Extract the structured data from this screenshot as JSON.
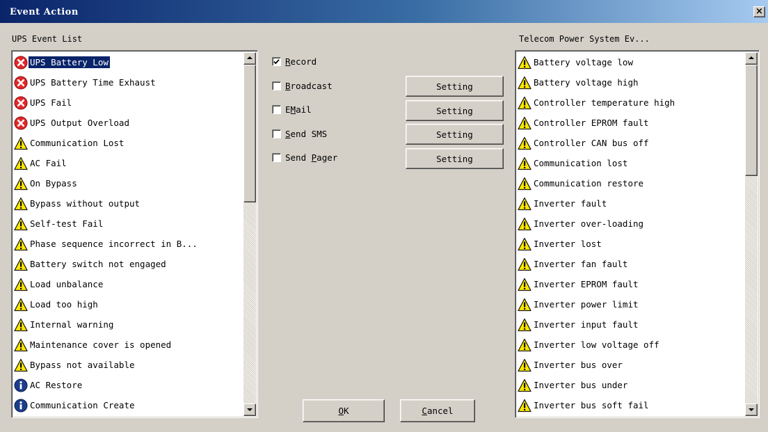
{
  "window": {
    "title": "Event Action",
    "close_label": "×"
  },
  "left_list": {
    "caption": "UPS Event List",
    "selected_index": 0,
    "items": [
      {
        "label": "UPS Battery Low",
        "icon": "error-icon"
      },
      {
        "label": "UPS Battery Time Exhaust",
        "icon": "error-icon"
      },
      {
        "label": "UPS Fail",
        "icon": "error-icon"
      },
      {
        "label": "UPS Output Overload",
        "icon": "error-icon"
      },
      {
        "label": "Communication Lost",
        "icon": "warning-icon"
      },
      {
        "label": "AC Fail",
        "icon": "warning-icon"
      },
      {
        "label": "On Bypass",
        "icon": "warning-icon"
      },
      {
        "label": "Bypass without output",
        "icon": "warning-icon"
      },
      {
        "label": "Self-test Fail",
        "icon": "warning-icon"
      },
      {
        "label": "Phase sequence incorrect in B...",
        "icon": "warning-icon"
      },
      {
        "label": "Battery switch not engaged",
        "icon": "warning-icon"
      },
      {
        "label": "Load unbalance",
        "icon": "warning-icon"
      },
      {
        "label": "Load too high",
        "icon": "warning-icon"
      },
      {
        "label": "Internal warning",
        "icon": "warning-icon"
      },
      {
        "label": "Maintenance cover is opened",
        "icon": "warning-icon"
      },
      {
        "label": "Bypass not available",
        "icon": "warning-icon"
      },
      {
        "label": "AC Restore",
        "icon": "info-icon"
      },
      {
        "label": "Communication Create",
        "icon": "info-icon"
      }
    ]
  },
  "right_list": {
    "caption": "Telecom Power System Ev...",
    "items": [
      {
        "label": "Battery voltage low",
        "icon": "warning-icon"
      },
      {
        "label": "Battery voltage high",
        "icon": "warning-icon"
      },
      {
        "label": "Controller temperature high",
        "icon": "warning-icon"
      },
      {
        "label": "Controller EPROM fault",
        "icon": "warning-icon"
      },
      {
        "label": "Controller CAN bus off",
        "icon": "warning-icon"
      },
      {
        "label": "Communication lost",
        "icon": "warning-icon"
      },
      {
        "label": "Communication restore",
        "icon": "warning-icon"
      },
      {
        "label": "Inverter fault",
        "icon": "warning-icon"
      },
      {
        "label": "Inverter over-loading",
        "icon": "warning-icon"
      },
      {
        "label": "Inverter lost",
        "icon": "warning-icon"
      },
      {
        "label": "Inverter fan fault",
        "icon": "warning-icon"
      },
      {
        "label": "Inverter EPROM fault",
        "icon": "warning-icon"
      },
      {
        "label": "Inverter power limit",
        "icon": "warning-icon"
      },
      {
        "label": "Inverter input fault",
        "icon": "warning-icon"
      },
      {
        "label": "Inverter low voltage off",
        "icon": "warning-icon"
      },
      {
        "label": "Inverter bus over",
        "icon": "warning-icon"
      },
      {
        "label": "Inverter bus under",
        "icon": "warning-icon"
      },
      {
        "label": "Inverter bus soft fail",
        "icon": "warning-icon"
      }
    ]
  },
  "actions": {
    "record": {
      "label_pre": "",
      "mnemonic": "R",
      "label_post": "ecord",
      "checked": true
    },
    "broadcast": {
      "label_pre": "",
      "mnemonic": "B",
      "label_post": "roadcast",
      "checked": false
    },
    "email": {
      "label_pre": "E",
      "mnemonic": "M",
      "label_post": "ail",
      "checked": false
    },
    "send_sms": {
      "label_pre": "",
      "mnemonic": "S",
      "label_post": "end SMS",
      "checked": false
    },
    "send_pager": {
      "label_pre": "Send ",
      "mnemonic": "P",
      "label_post": "ager",
      "checked": false
    },
    "setting_label": "Setting"
  },
  "footer": {
    "ok": {
      "mnemonic": "O",
      "rest": "K"
    },
    "cancel": {
      "mnemonic": "C",
      "rest": "ancel"
    }
  },
  "colors": {
    "titlebar_start": "#0a246a",
    "titlebar_end": "#a6caf0",
    "selection": "#0a246a",
    "error_red": "#e0282a",
    "warning_yellow": "#ffe800",
    "info_blue": "#1c3d8a"
  }
}
